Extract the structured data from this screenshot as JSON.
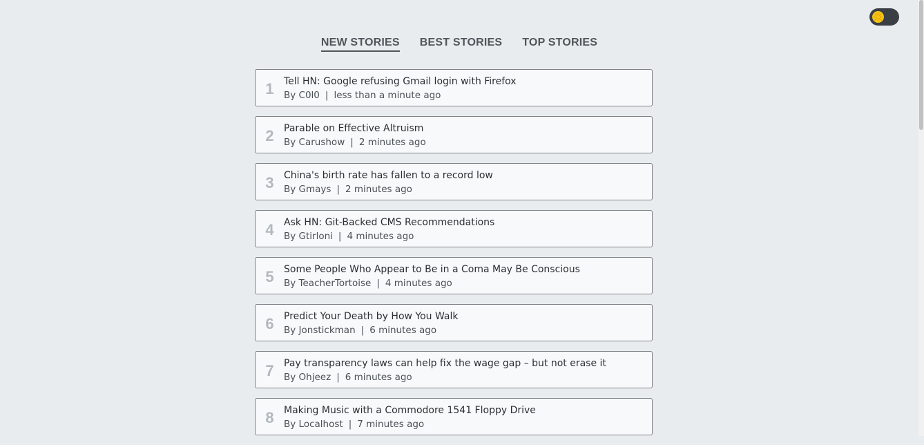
{
  "header": {
    "tabs": [
      {
        "label": "NEW STORIES",
        "active": true
      },
      {
        "label": "BEST STORIES",
        "active": false
      },
      {
        "label": "TOP STORIES",
        "active": false
      }
    ],
    "theme_toggle": {
      "icon": "sun-icon",
      "mode": "light"
    }
  },
  "colors": {
    "background": "#e9ecef",
    "card": "#f8f9fa",
    "toggle_track": "#3a3f45",
    "toggle_knob": "#f5c518"
  },
  "stories": [
    {
      "rank": "1",
      "title": "Tell HN: Google refusing Gmail login with Firefox",
      "by": "By C0l0",
      "sep": "|",
      "time": "less than a minute ago"
    },
    {
      "rank": "2",
      "title": "Parable on Effective Altruism",
      "by": "By Carushow",
      "sep": "|",
      "time": "2 minutes ago"
    },
    {
      "rank": "3",
      "title": "China's birth rate has fallen to a record low",
      "by": "By Gmays",
      "sep": "|",
      "time": "2 minutes ago"
    },
    {
      "rank": "4",
      "title": "Ask HN: Git-Backed CMS Recommendations",
      "by": "By Gtirloni",
      "sep": "|",
      "time": "4 minutes ago"
    },
    {
      "rank": "5",
      "title": "Some People Who Appear to Be in a Coma May Be Conscious",
      "by": "By TeacherTortoise",
      "sep": "|",
      "time": "4 minutes ago"
    },
    {
      "rank": "6",
      "title": "Predict Your Death by How You Walk",
      "by": "By Jonstickman",
      "sep": "|",
      "time": "6 minutes ago"
    },
    {
      "rank": "7",
      "title": "Pay transparency laws can help fix the wage gap – but not erase it",
      "by": "By Ohjeez",
      "sep": "|",
      "time": "6 minutes ago"
    },
    {
      "rank": "8",
      "title": "Making Music with a Commodore 1541 Floppy Drive",
      "by": "By Localhost",
      "sep": "|",
      "time": "7 minutes ago"
    }
  ]
}
